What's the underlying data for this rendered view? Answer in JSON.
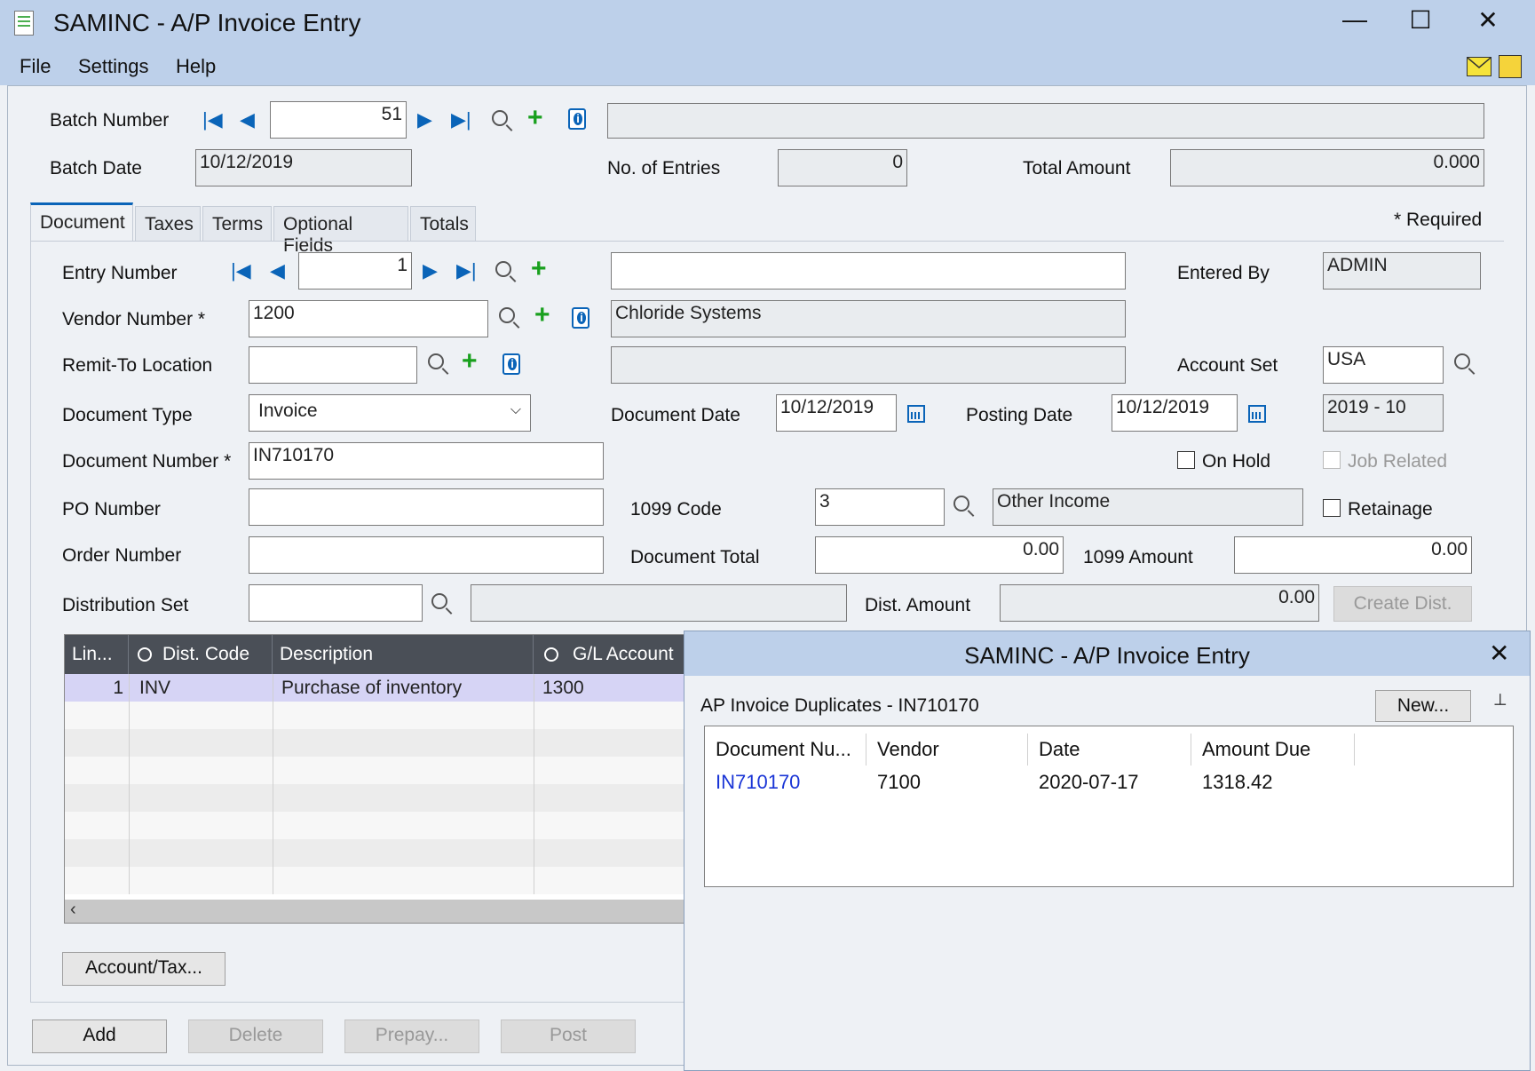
{
  "window": {
    "title": "SAMINC - A/P Invoice Entry",
    "minimize": "—",
    "maximize": "☐",
    "close": "✕"
  },
  "menu": {
    "file": "File",
    "settings": "Settings",
    "help": "Help"
  },
  "batch": {
    "number_label": "Batch Number",
    "number_value": "51",
    "description_value": "",
    "date_label": "Batch Date",
    "date_value": "10/12/2019",
    "entries_label": "No. of Entries",
    "entries_value": "0",
    "total_label": "Total Amount",
    "total_value": "0.000"
  },
  "tabs": [
    {
      "label": "Document"
    },
    {
      "label": "Taxes"
    },
    {
      "label": "Terms"
    },
    {
      "label": "Optional Fields"
    },
    {
      "label": "Totals"
    }
  ],
  "required_note": "* Required",
  "document": {
    "entry_number_label": "Entry Number",
    "entry_number_value": "1",
    "entry_description_value": "",
    "entered_by_label": "Entered By",
    "entered_by_value": "ADMIN",
    "vendor_number_label": "Vendor Number *",
    "vendor_number_value": "1200",
    "vendor_name_value": "Chloride Systems",
    "remit_to_label": "Remit-To Location",
    "remit_to_value": "",
    "remit_to_name_value": "",
    "account_set_label": "Account Set",
    "account_set_value": "USA",
    "document_type_label": "Document Type",
    "document_type_value": "Invoice",
    "document_date_label": "Document Date",
    "document_date_value": "10/12/2019",
    "posting_date_label": "Posting Date",
    "posting_date_value": "10/12/2019",
    "fiscal_period_value": "2019 - 10",
    "document_number_label": "Document Number *",
    "document_number_value": "IN710170",
    "on_hold_label": "On Hold",
    "job_related_label": "Job Related",
    "po_number_label": "PO Number",
    "po_number_value": "",
    "code_1099_label": "1099 Code",
    "code_1099_value": "3",
    "code_1099_desc_value": "Other Income",
    "retainage_label": "Retainage",
    "order_number_label": "Order Number",
    "order_number_value": "",
    "document_total_label": "Document Total",
    "document_total_value": "0.00",
    "amount_1099_label": "1099 Amount",
    "amount_1099_value": "0.00",
    "dist_set_label": "Distribution Set",
    "dist_set_value": "",
    "dist_set_desc_value": "",
    "dist_amount_label": "Dist. Amount",
    "dist_amount_value": "0.00",
    "create_dist_label": "Create Dist."
  },
  "grid": {
    "headers": [
      "Lin...",
      "Dist. Code",
      "Description",
      "G/L Account"
    ],
    "rows": [
      {
        "line": "1",
        "dist_code": "INV",
        "description": "Purchase of inventory",
        "gl_account": "1300"
      }
    ]
  },
  "buttons": {
    "account_tax": "Account/Tax...",
    "add": "Add",
    "delete": "Delete",
    "prepay": "Prepay...",
    "post": "Post"
  },
  "popup": {
    "title": "SAMINC - A/P Invoice Entry",
    "close": "✕",
    "subtitle": "AP Invoice Duplicates - IN710170",
    "new_button": "New...",
    "pin": "⊣",
    "headers": [
      "Document Nu...",
      "Vendor",
      "Date",
      "Amount Due"
    ],
    "rows": [
      {
        "document": "IN710170",
        "vendor": "7100",
        "date": "2020-07-17",
        "amount_due": "1318.42"
      }
    ]
  },
  "colors": {
    "title_bar": "#bdd0ea",
    "link": "#1a35d6",
    "accent": "#0a64b8",
    "add_green": "#19a01e"
  }
}
